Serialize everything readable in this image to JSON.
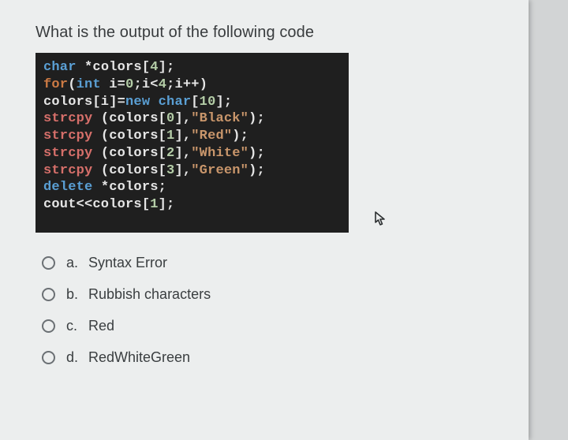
{
  "question": "What is the output of the following code",
  "code": {
    "l1": {
      "kw1": "char",
      "rest": " *colors[",
      "n": "4",
      "end": "];"
    },
    "l2": {
      "kw1": "for",
      "p1": "(",
      "kw2": "int",
      "sp": " i=",
      "n0": "0",
      "semi": ";i<",
      "n1": "4",
      "inc": ";i++)"
    },
    "l3": {
      "pre": "  colors[i]=",
      "kw": "new",
      "sp": " ",
      "ty": "char",
      "br": "[",
      "n": "10",
      "end": "];"
    },
    "l4": {
      "fn": "strcpy",
      "mid": " (colors[",
      "n": "0",
      "c": "],",
      "s": "\"Black\"",
      "end": ");"
    },
    "l5": {
      "fn": "strcpy",
      "mid": " (colors[",
      "n": "1",
      "c": "],",
      "s": "\"Red\"",
      "end": ");"
    },
    "l6": {
      "fn": "strcpy",
      "mid": " (colors[",
      "n": "2",
      "c": "],",
      "s": "\"White\"",
      "end": ");"
    },
    "l7": {
      "fn": "strcpy",
      "mid": " (colors[",
      "n": "3",
      "c": "],",
      "s": "\"Green\"",
      "end": ");"
    },
    "l8": {
      "kw": "delete",
      "rest": " *colors;"
    },
    "l9": {
      "cout": "cout<<colors[",
      "n": "1",
      "end": "];"
    }
  },
  "options": [
    {
      "letter": "a.",
      "text": "Syntax Error"
    },
    {
      "letter": "b.",
      "text": "Rubbish characters"
    },
    {
      "letter": "c.",
      "text": "Red"
    },
    {
      "letter": "d.",
      "text": "RedWhiteGreen"
    }
  ]
}
